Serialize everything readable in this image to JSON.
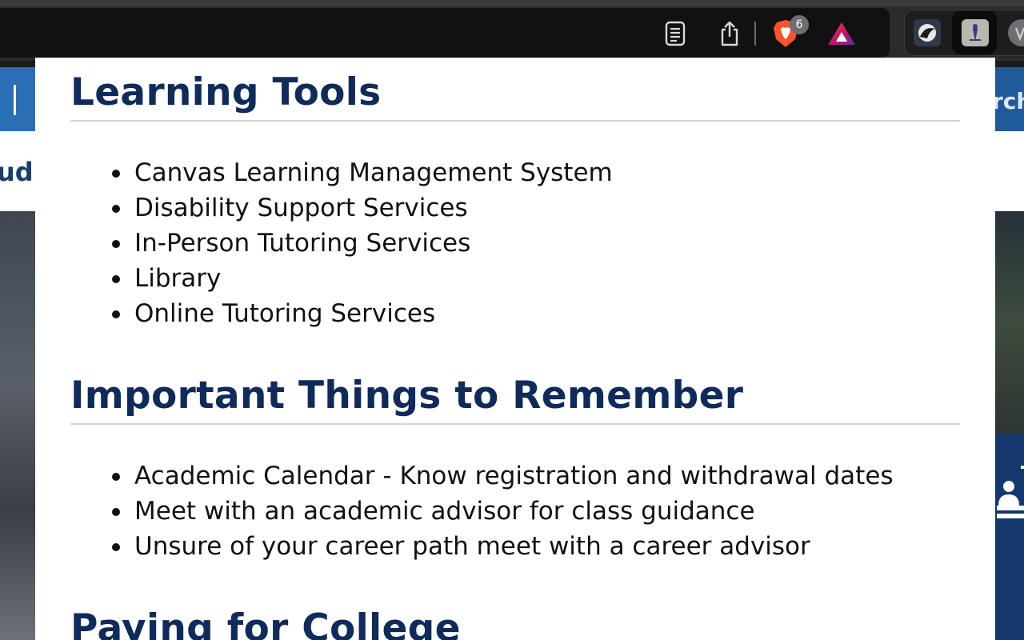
{
  "browser": {
    "shields_badge": "6",
    "icons": [
      "reader-mode-icon",
      "share-icon",
      "brave-shields-icon",
      "brave-rewards-icon",
      "extension-icon"
    ]
  },
  "background_page": {
    "left_fragment": "ud",
    "right_fragment": "rch"
  },
  "panel": {
    "sections": [
      {
        "heading": "Learning Tools",
        "items": [
          "Canvas Learning Management System",
          "Disability Support Services",
          "In-Person Tutoring Services",
          "Library",
          "Online Tutoring Services"
        ]
      },
      {
        "heading": "Important Things to Remember",
        "items": [
          "Academic Calendar - Know registration and withdrawal dates",
          "Meet with an academic advisor for class guidance",
          "Unsure of your career path meet with a career advisor"
        ]
      },
      {
        "heading": "Paying for College",
        "items": []
      }
    ]
  },
  "colors": {
    "heading": "#0f2b5b",
    "text": "#111111",
    "toolbar": "#111113",
    "brave_orange": "#fb542b"
  }
}
